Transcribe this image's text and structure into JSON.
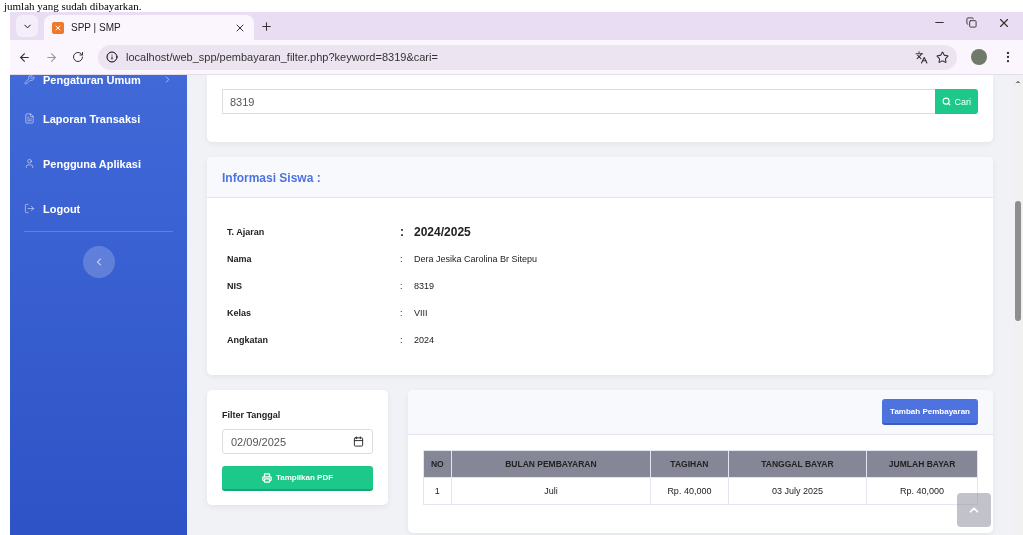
{
  "document_text": "jumlah yang sudah dibayarkan.",
  "browser": {
    "tab_title": "SPP | SMP",
    "url": "localhost/web_spp/pembayaran_filter.php?keyword=8319&cari="
  },
  "sidebar": {
    "items": [
      {
        "label": "Pengaturan Umum",
        "expandable": true
      },
      {
        "label": "Laporan Transaksi",
        "expandable": false
      },
      {
        "label": "Pengguna Aplikasi",
        "expandable": false
      },
      {
        "label": "Logout",
        "expandable": false
      }
    ]
  },
  "search": {
    "value": "8319",
    "button": "Cari"
  },
  "student_info": {
    "title": "Informasi Siswa :",
    "fields": [
      {
        "label": "T. Ajaran",
        "separator": ":",
        "value": "2024/2025",
        "emphasized": true
      },
      {
        "label": "Nama",
        "separator": ":",
        "value": "Dera Jesika Carolina Br Sitepu",
        "emphasized": false
      },
      {
        "label": "NIS",
        "separator": ":",
        "value": "8319",
        "emphasized": false
      },
      {
        "label": "Kelas",
        "separator": ":",
        "value": "VIII",
        "emphasized": false
      },
      {
        "label": "Angkatan",
        "separator": ":",
        "value": "2024",
        "emphasized": false
      }
    ]
  },
  "filter": {
    "label": "Filter Tanggal",
    "date": "02/09/2025",
    "button": "Tampilkan PDF"
  },
  "payments": {
    "add_button": "Tambah Pembayaran",
    "columns": [
      "NO",
      "BULAN PEMBAYARAN",
      "TAGIHAN",
      "TANGGAL BAYAR",
      "JUMLAH BAYAR"
    ],
    "rows": [
      [
        "1",
        "Juli",
        "Rp. 40,000",
        "03 July 2025",
        "Rp. 40,000"
      ]
    ]
  }
}
